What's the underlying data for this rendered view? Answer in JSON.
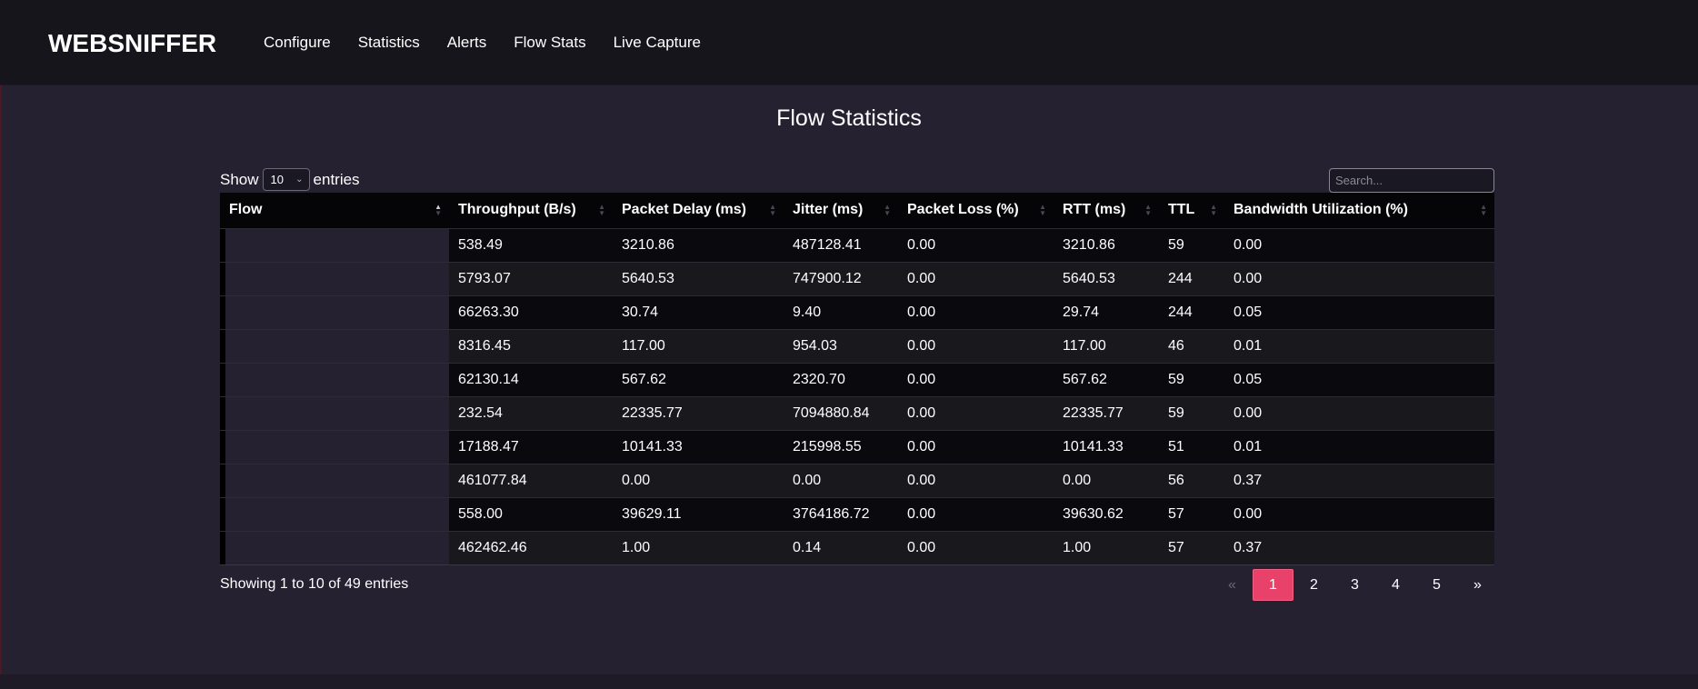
{
  "brand": "WEBSNIFFER",
  "nav": [
    "Configure",
    "Statistics",
    "Alerts",
    "Flow Stats",
    "Live Capture"
  ],
  "page_title": "Flow Statistics",
  "length": {
    "show_label": "Show",
    "value": "10",
    "entries_label": "entries"
  },
  "search": {
    "placeholder": "Search..."
  },
  "columns": [
    "Flow",
    "Throughput (B/s)",
    "Packet Delay (ms)",
    "Jitter (ms)",
    "Packet Loss (%)",
    "RTT (ms)",
    "TTL",
    "Bandwidth Utilization (%)"
  ],
  "sorted_column": "Flow",
  "sort_direction": "ascending",
  "rows": [
    [
      "538.49",
      "3210.86",
      "487128.41",
      "0.00",
      "3210.86",
      "59",
      "0.00"
    ],
    [
      "5793.07",
      "5640.53",
      "747900.12",
      "0.00",
      "5640.53",
      "244",
      "0.00"
    ],
    [
      "66263.30",
      "30.74",
      "9.40",
      "0.00",
      "29.74",
      "244",
      "0.05"
    ],
    [
      "8316.45",
      "117.00",
      "954.03",
      "0.00",
      "117.00",
      "46",
      "0.01"
    ],
    [
      "62130.14",
      "567.62",
      "2320.70",
      "0.00",
      "567.62",
      "59",
      "0.05"
    ],
    [
      "232.54",
      "22335.77",
      "7094880.84",
      "0.00",
      "22335.77",
      "59",
      "0.00"
    ],
    [
      "17188.47",
      "10141.33",
      "215998.55",
      "0.00",
      "10141.33",
      "51",
      "0.01"
    ],
    [
      "461077.84",
      "0.00",
      "0.00",
      "0.00",
      "0.00",
      "56",
      "0.37"
    ],
    [
      "558.00",
      "39629.11",
      "3764186.72",
      "0.00",
      "39630.62",
      "57",
      "0.00"
    ],
    [
      "462462.46",
      "1.00",
      "0.14",
      "0.00",
      "1.00",
      "57",
      "0.37"
    ]
  ],
  "info": "Showing 1 to 10 of 49 entries",
  "pagination": {
    "prev": "«",
    "pages": [
      "1",
      "2",
      "3",
      "4",
      "5"
    ],
    "next": "»",
    "current": "1"
  },
  "colors": {
    "accent": "#e8416a",
    "background": "#252131",
    "navbar": "#17151c"
  }
}
